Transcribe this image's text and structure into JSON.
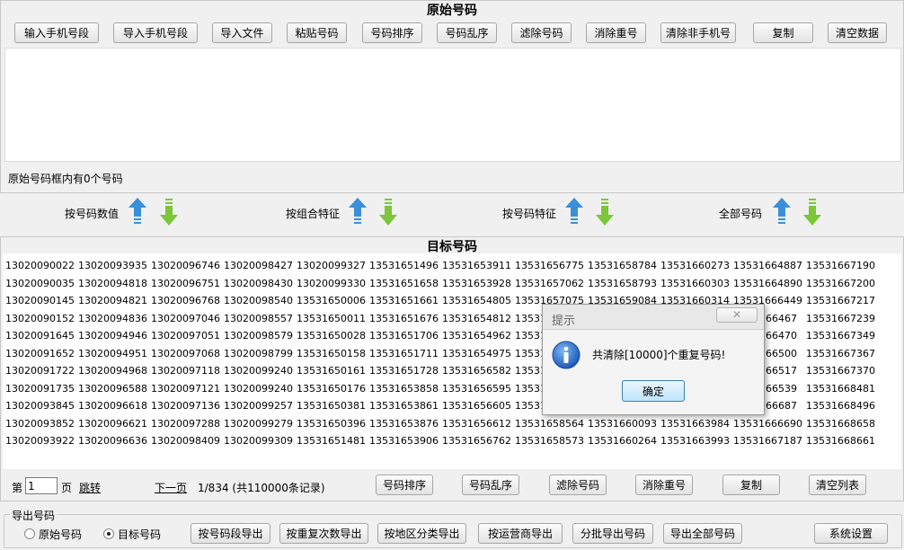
{
  "top": {
    "title": "原始号码",
    "buttons": [
      "输入手机号段",
      "导入手机号段",
      "导入文件",
      "粘贴号码",
      "号码排序",
      "号码乱序",
      "滤除号码",
      "消除重号",
      "清除非手机号",
      "复制",
      "清空数据"
    ],
    "status": "原始号码框内有0个号码"
  },
  "sort_bar": {
    "items": [
      "按号码数值",
      "按组合特征",
      "按号码特征",
      "全部号码"
    ]
  },
  "target": {
    "title": "目标号码",
    "columns": [
      [
        "13020090022",
        "13020090035",
        "13020090145",
        "13020090152",
        "13020091645",
        "13020091652",
        "13020091722",
        "13020091735",
        "13020093845",
        "13020093852",
        "13020093922"
      ],
      [
        "13020093935",
        "13020094818",
        "13020094821",
        "13020094836",
        "13020094946",
        "13020094951",
        "13020094968",
        "13020096588",
        "13020096618",
        "13020096621",
        "13020096636"
      ],
      [
        "13020096746",
        "13020096751",
        "13020096768",
        "13020097046",
        "13020097051",
        "13020097068",
        "13020097118",
        "13020097121",
        "13020097136",
        "13020097288",
        "13020098409"
      ],
      [
        "13020098427",
        "13020098430",
        "13020098540",
        "13020098557",
        "13020098579",
        "13020098799",
        "13020099240",
        "13020099240",
        "13020099257",
        "13020099279",
        "13020099309"
      ],
      [
        "13020099327",
        "13020099330",
        "13531650006",
        "13531650011",
        "13531650028",
        "13531650158",
        "13531650161",
        "13531650176",
        "13531650381",
        "13531650396",
        "13531651481"
      ],
      [
        "13531651496",
        "13531651658",
        "13531651661",
        "13531651676",
        "13531651706",
        "13531651711",
        "13531651728",
        "13531653858",
        "13531653861",
        "13531653876",
        "13531653906"
      ],
      [
        "13531653911",
        "13531653928",
        "13531654805",
        "13531654812",
        "13531654962",
        "13531654975",
        "13531656582",
        "13531656595",
        "13531656605",
        "13531656612",
        "13531656762"
      ],
      [
        "13531656775",
        "13531657062",
        "13531657075",
        "13531",
        "13531",
        "13531",
        "13531",
        "13531",
        "13531",
        "13531658564",
        "13531658573"
      ],
      [
        "13531658784",
        "13531658793",
        "13531659084",
        "",
        "",
        "",
        "",
        "",
        "",
        "13531660093",
        "13531660264"
      ],
      [
        "13531660273",
        "13531660303",
        "13531660314",
        "",
        "",
        "",
        "",
        "",
        "",
        "13531663984",
        "13531663993"
      ],
      [
        "13531664887",
        "13531664890",
        "13531666449",
        "66467",
        "66470",
        "66500",
        "66517",
        "66539",
        "66687",
        "13531666690",
        "13531667187"
      ],
      [
        "13531667190",
        "13531667200",
        "13531667217",
        "13531667239",
        "13531667349",
        "13531667367",
        "13531667370",
        "13531668481",
        "13531668496",
        "13531668658",
        "13531668661"
      ]
    ],
    "pager": {
      "page_prefix": "第",
      "page_value": "1",
      "page_suffix": "页",
      "jump": "跳转",
      "next": "下一页",
      "info": "1/834 (共110000条记录)"
    },
    "buttons": [
      "号码排序",
      "号码乱序",
      "滤除号码",
      "消除重号",
      "复制",
      "清空列表"
    ]
  },
  "export": {
    "group_label": "导出号码",
    "radio_original": "原始号码",
    "radio_target": "目标号码",
    "buttons": [
      "按号码段导出",
      "按重复次数导出",
      "按地区分类导出",
      "按运营商导出",
      "分批导出号码",
      "导出全部号码"
    ],
    "settings": "系统设置"
  },
  "dialog": {
    "title": "提示",
    "message": "共清除[10000]个重复号码!",
    "ok": "确定"
  },
  "colors": {
    "arrow_up": "#3a8fd8",
    "arrow_down": "#7cc63a"
  }
}
